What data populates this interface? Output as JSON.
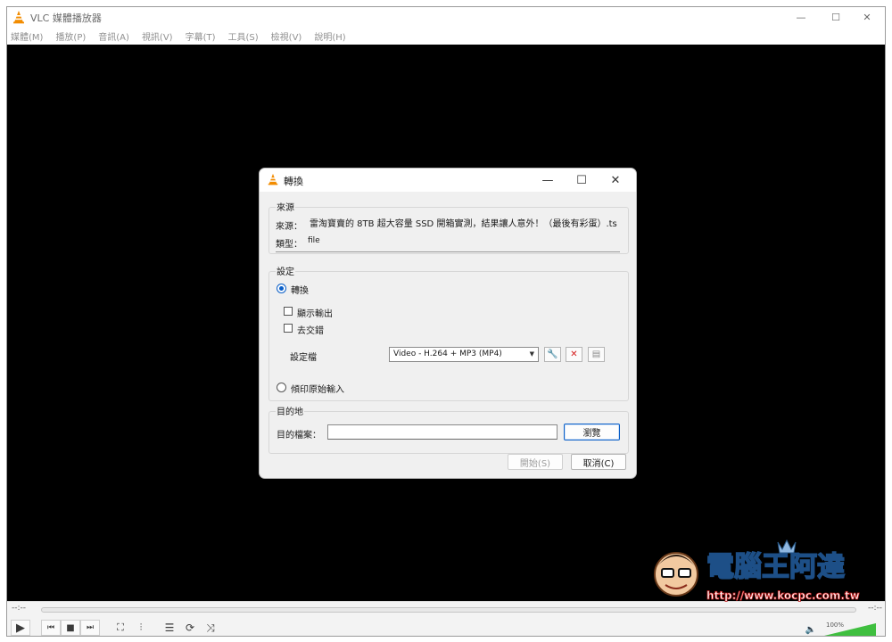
{
  "window": {
    "title": "VLC 媒體播放器",
    "minimize_glyph": "—",
    "maximize_glyph": "☐",
    "close_glyph": "✕"
  },
  "menu": [
    "媒體(M)",
    "播放(P)",
    "音訊(A)",
    "視訊(V)",
    "字幕(T)",
    "工具(S)",
    "檢視(V)",
    "說明(H)"
  ],
  "controls": {
    "time_elapsed": "--:--",
    "time_total": "--:--",
    "volume_label": "100%",
    "volume_level": 1.0,
    "icons": {
      "play": "▶",
      "prev": "⏮",
      "stop": "■",
      "next": "⏭",
      "fullscreen": "⛶",
      "extended": "⫶",
      "playlist": "☰",
      "loop": "⟳",
      "random": "⤨",
      "mute": "🔈"
    }
  },
  "dialog": {
    "title": "轉換",
    "minimize_glyph": "—",
    "maximize_glyph": "☐",
    "close_glyph": "✕",
    "source_group": "來源",
    "source_label": "來源：",
    "source_value": "雷淘寶賣的 8TB 超大容量 SSD 開箱實測，結果讓人意外！（最後有彩蛋）.ts",
    "type_label": "類型：",
    "type_value": "file",
    "settings_group": "設定",
    "convert_label": "轉換",
    "display_output_label": "顯示輸出",
    "deinterlace_label": "去交錯",
    "profile_label": "設定檔",
    "profile_value": "Video - H.264 + MP3 (MP4)",
    "profile_icons": {
      "edit": "🔧",
      "delete": "✕",
      "new": "▤"
    },
    "dump_label": "傾印原始輸入",
    "destination_group": "目的地",
    "dest_file_label": "目的檔案：",
    "dest_file_value": "",
    "browse_label": "瀏覽",
    "start_label": "開始(S)",
    "cancel_label": "取消(C)"
  },
  "watermark": {
    "text": "電腦王阿達",
    "url": "http://www.kocpc.com.tw"
  },
  "colors": {
    "accent": "#0a5fc8",
    "vlc_orange": "#f28c00",
    "delete_red": "#d41b1b",
    "video_bg": "#000000"
  }
}
